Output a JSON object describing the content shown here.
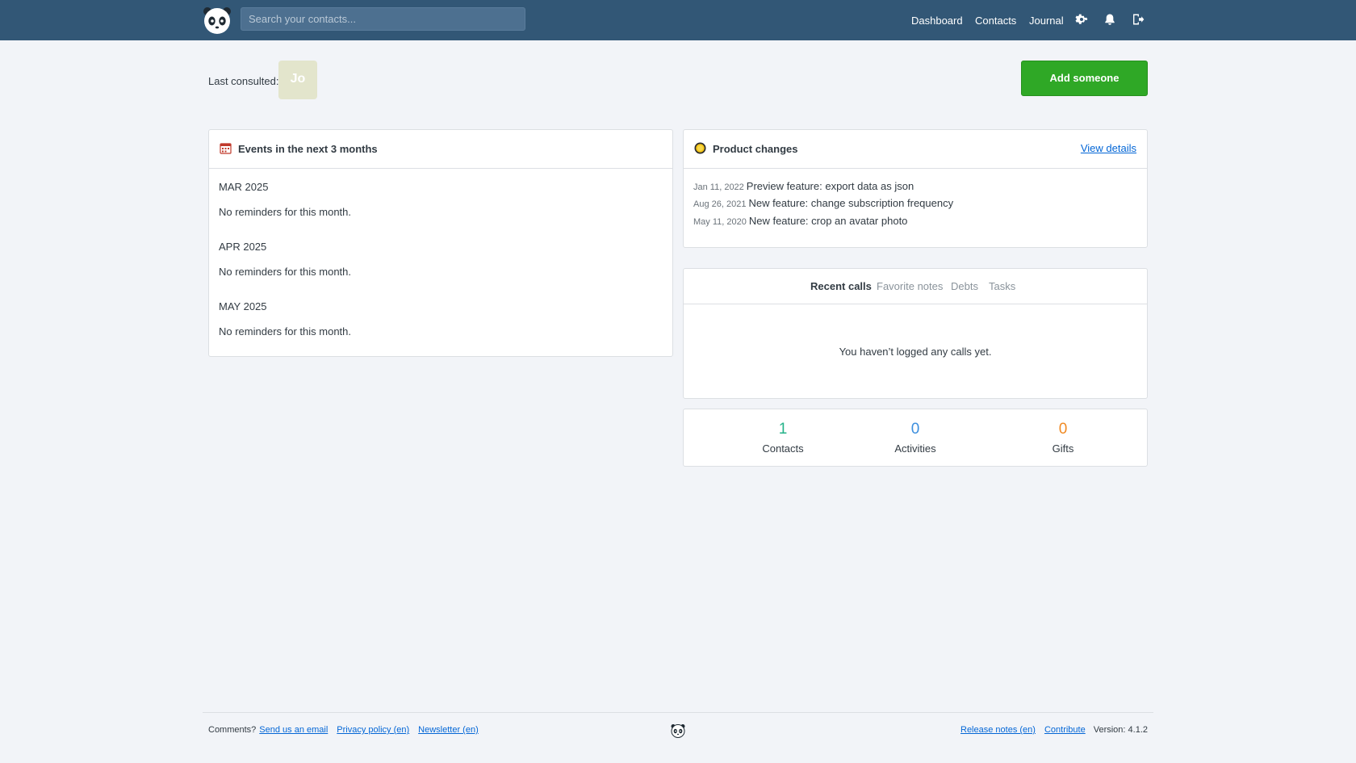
{
  "header": {
    "search_placeholder": "Search your contacts...",
    "nav": {
      "dashboard": "Dashboard",
      "contacts": "Contacts",
      "journal": "Journal"
    }
  },
  "top": {
    "last_consulted_label": "Last consulted:",
    "avatar_initials": "Jo",
    "add_button": "Add someone"
  },
  "events": {
    "title": "Events in the next 3 months",
    "months": [
      {
        "label": "MAR 2025",
        "empty": "No reminders for this month."
      },
      {
        "label": "APR 2025",
        "empty": "No reminders for this month."
      },
      {
        "label": "MAY 2025",
        "empty": "No reminders for this month."
      }
    ]
  },
  "product_changes": {
    "title": "Product changes",
    "view_details": "View details",
    "items": [
      {
        "date": "Jan 11, 2022",
        "text": "Preview feature: export data as json"
      },
      {
        "date": "Aug 26, 2021",
        "text": "New feature: change subscription frequency"
      },
      {
        "date": "May 11, 2020",
        "text": "New feature: crop an avatar photo"
      }
    ]
  },
  "tabs": {
    "items": [
      "Recent calls",
      "Favorite notes",
      "Debts",
      "Tasks"
    ],
    "active": "Recent calls",
    "empty_text": "You haven’t logged any calls yet."
  },
  "stats": [
    {
      "value": "1",
      "label": "Contacts",
      "color": "#26b38a"
    },
    {
      "value": "0",
      "label": "Activities",
      "color": "#3d8fde"
    },
    {
      "value": "0",
      "label": "Gifts",
      "color": "#f08a24"
    }
  ],
  "footer": {
    "comments": "Comments?",
    "send_email": "Send us an email",
    "privacy": "Privacy policy (en)",
    "newsletter": "Newsletter (en)",
    "release_notes": "Release notes (en)",
    "contribute": "Contribute",
    "version": "Version: 4.1.2"
  },
  "colors": {
    "header_bg": "#325776",
    "primary_button": "#2fa826",
    "link": "#0366d6"
  }
}
